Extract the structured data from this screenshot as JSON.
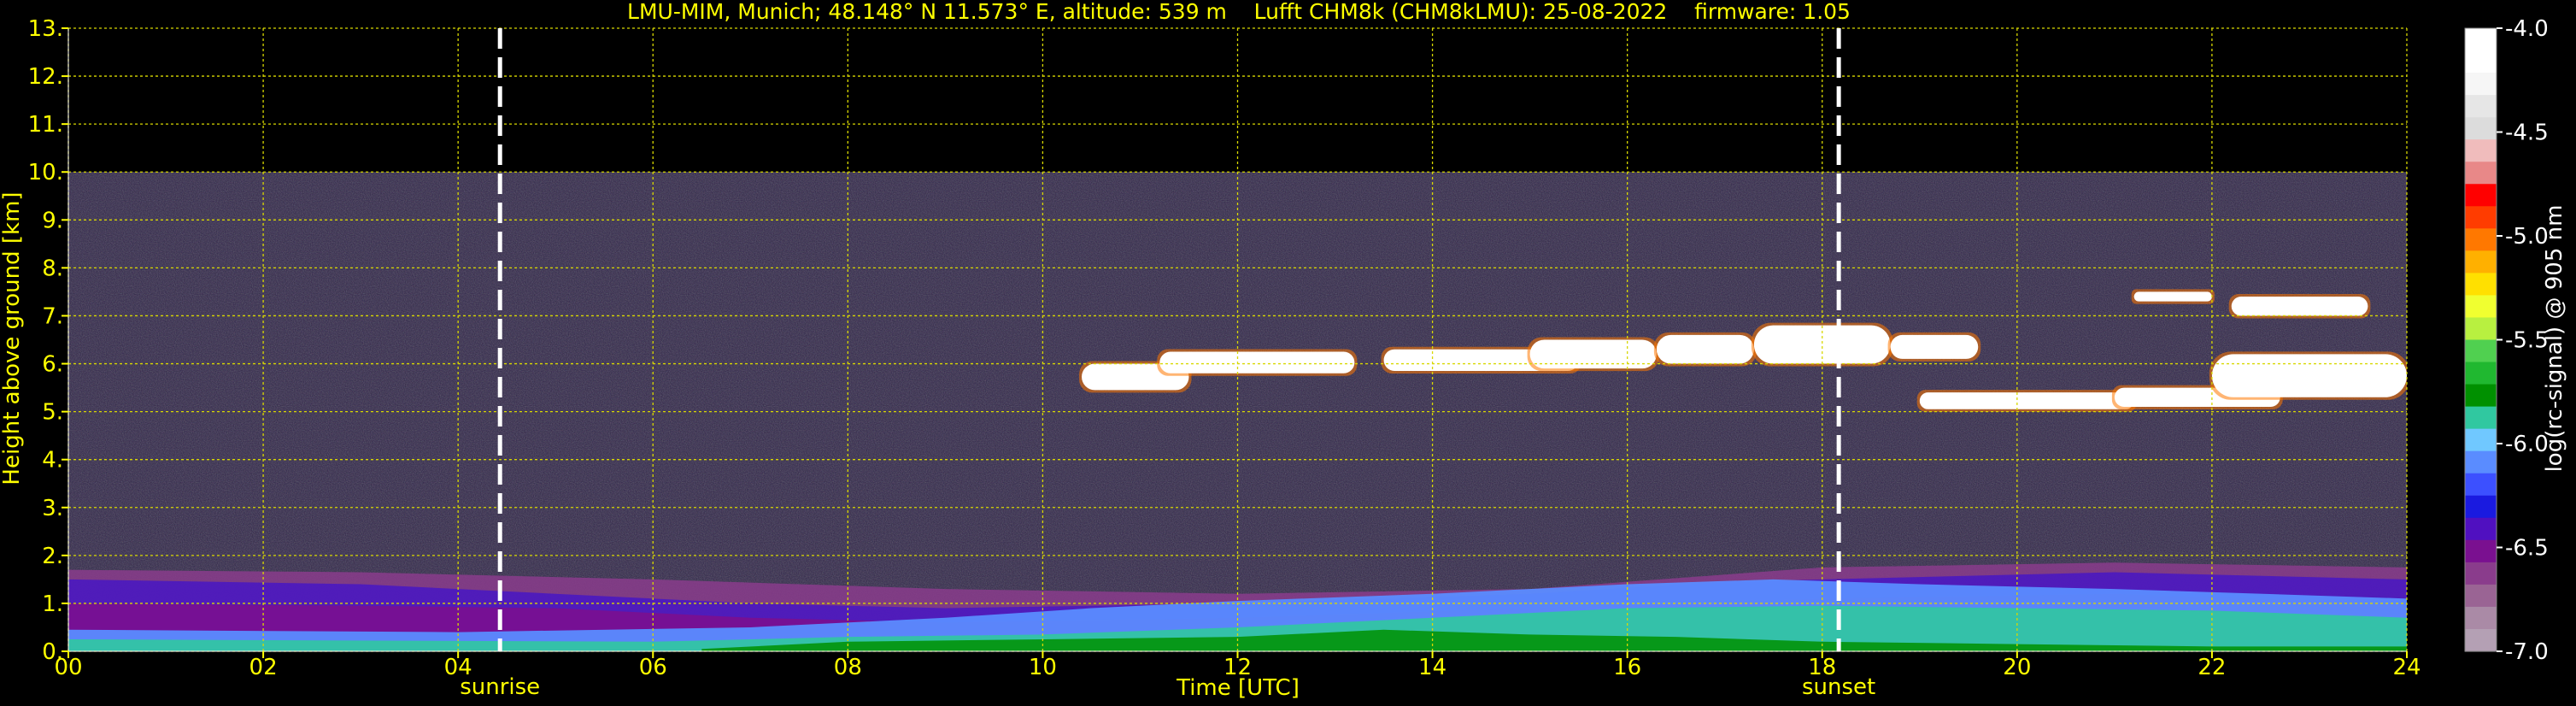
{
  "chart_data": {
    "type": "heatmap",
    "title": "LMU-MIM, Munich; 48.148° N 11.573° E, altitude: 539 m    Lufft CHM8k (CHM8kLMU): 25-08-2022    firmware: 1.05",
    "xlabel": "Time [UTC]",
    "ylabel": "Height above ground [km]",
    "xlim": [
      0,
      24
    ],
    "ylim": [
      0,
      13
    ],
    "x_ticks": [
      0,
      2,
      4,
      6,
      8,
      10,
      12,
      14,
      16,
      18,
      20,
      22,
      24
    ],
    "x_tick_labels": [
      "00",
      "02",
      "04",
      "06",
      "08",
      "10",
      "12",
      "14",
      "16",
      "18",
      "20",
      "22",
      "24"
    ],
    "y_ticks": [
      0,
      1,
      2,
      3,
      4,
      5,
      6,
      7,
      8,
      9,
      10,
      11,
      12,
      13
    ],
    "y_tick_labels": [
      "0.",
      "1.",
      "2.",
      "3.",
      "4.",
      "5.",
      "6.",
      "7.",
      "8.",
      "9.",
      "10.",
      "11.",
      "12.",
      "13."
    ],
    "grid": true,
    "data_max_height_km": 10,
    "markers": [
      {
        "label": "sunrise",
        "time_utc": 4.43
      },
      {
        "label": "sunset",
        "time_utc": 18.17
      }
    ],
    "colorbar": {
      "label": "log(rc-signal) @ 905 nm",
      "range": [
        -7.0,
        -4.0
      ],
      "tick_values": [
        -4.0,
        -4.5,
        -5.0,
        -5.5,
        -6.0,
        -6.5,
        -7.0
      ],
      "tick_labels": [
        "-4.0",
        "-4.5",
        "-5.0",
        "-5.5",
        "-6.0",
        "-6.5",
        "-7.0"
      ],
      "colors": [
        "#ffffff",
        "#ffffff",
        "#f6f6f6",
        "#e6e6e6",
        "#dcdcdc",
        "#f0bcbc",
        "#e88888",
        "#ff0000",
        "#ff3c00",
        "#ff7800",
        "#ffb000",
        "#ffe000",
        "#f0ff30",
        "#b8f040",
        "#50d050",
        "#20b830",
        "#009000",
        "#30c8a0",
        "#70c8ff",
        "#5a8cff",
        "#3c50ff",
        "#1a1ae0",
        "#5010c0",
        "#7a1090",
        "#8a3c8c",
        "#9a6494",
        "#aa8aa6",
        "#b4a0b4"
      ]
    }
  },
  "colors": {
    "text": "#ffff00",
    "grid": "#d8d800",
    "marker": "#ffffff",
    "background": "#000000",
    "noise": "#2e2446"
  }
}
